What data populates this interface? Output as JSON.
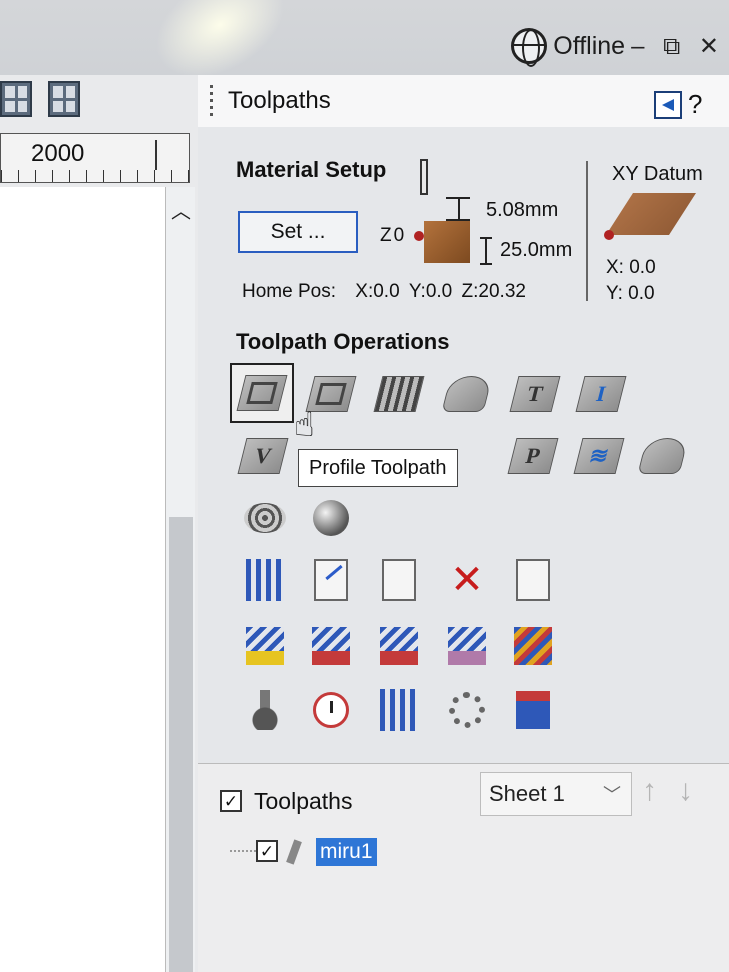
{
  "status": {
    "connection": "Offline",
    "window_controls": "– ⧉ ✕"
  },
  "left_panel": {
    "ruler_value": "2000"
  },
  "panel": {
    "title": "Toolpaths"
  },
  "material_setup": {
    "title": "Material Setup",
    "set_button": "Set ...",
    "z_zero": "Z0",
    "dim_top": "5.08mm",
    "dim_bottom": "25.0mm",
    "home_pos_label": "Home Pos:",
    "home_pos_x": "X:0.0",
    "home_pos_y": "Y:0.0",
    "home_pos_z": "Z:20.32",
    "xy_datum_title": "XY Datum",
    "xy_x": "X: 0.0",
    "xy_y": "Y: 0.0"
  },
  "operations": {
    "title": "Toolpath Operations",
    "tooltip": "Profile Toolpath",
    "row1": [
      "profile-icon",
      "pocket-icon",
      "drilling-icon",
      "inlay-icon",
      "quick-engrave-icon",
      "texture-icon"
    ],
    "row2": [
      "vcarve-icon",
      "prism-icon",
      "fluting-icon",
      "moulding-icon",
      "decal-icon",
      "3d-roughing-icon",
      "3d-finishing-icon"
    ],
    "row3": [
      "ripple-icon",
      "sphere-icon"
    ]
  },
  "toolpath_list": {
    "header_label": "Toolpaths",
    "sheet_select": "Sheet 1",
    "items": [
      {
        "name": "miru1",
        "checked": true
      }
    ]
  },
  "colors": {
    "accent_blue": "#2e76d6",
    "selection_border": "#2a5dc0",
    "material_brown": "#9a5e2d",
    "datum_red": "#b02222"
  }
}
